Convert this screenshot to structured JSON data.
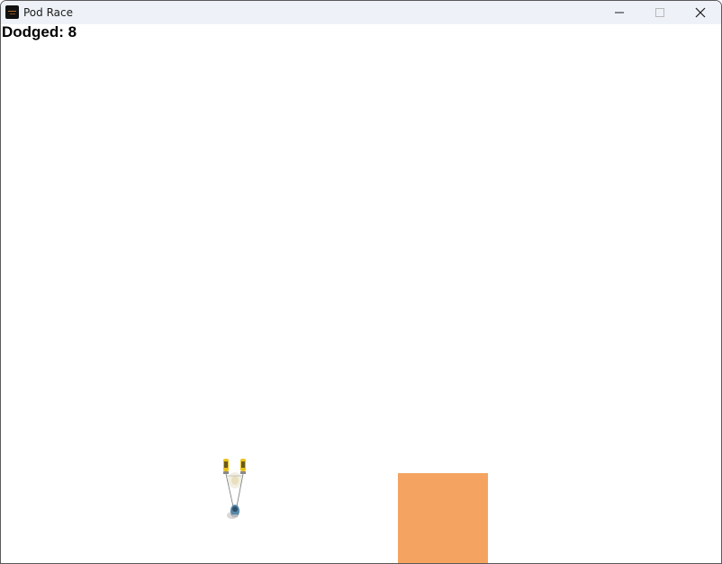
{
  "window": {
    "title": "Pod Race",
    "icon": "pod-race-app-icon",
    "controls": {
      "minimize_icon": "minimize-icon",
      "maximize_icon": "maximize-icon",
      "close_icon": "close-icon"
    }
  },
  "hud": {
    "score_text": "Dodged: 8"
  },
  "game": {
    "background_color": "#ffffff",
    "player": {
      "sprite": "podracer-sprite",
      "engine_color": "#e8c21a"
    },
    "obstacle": {
      "color": "#f4a460"
    }
  }
}
